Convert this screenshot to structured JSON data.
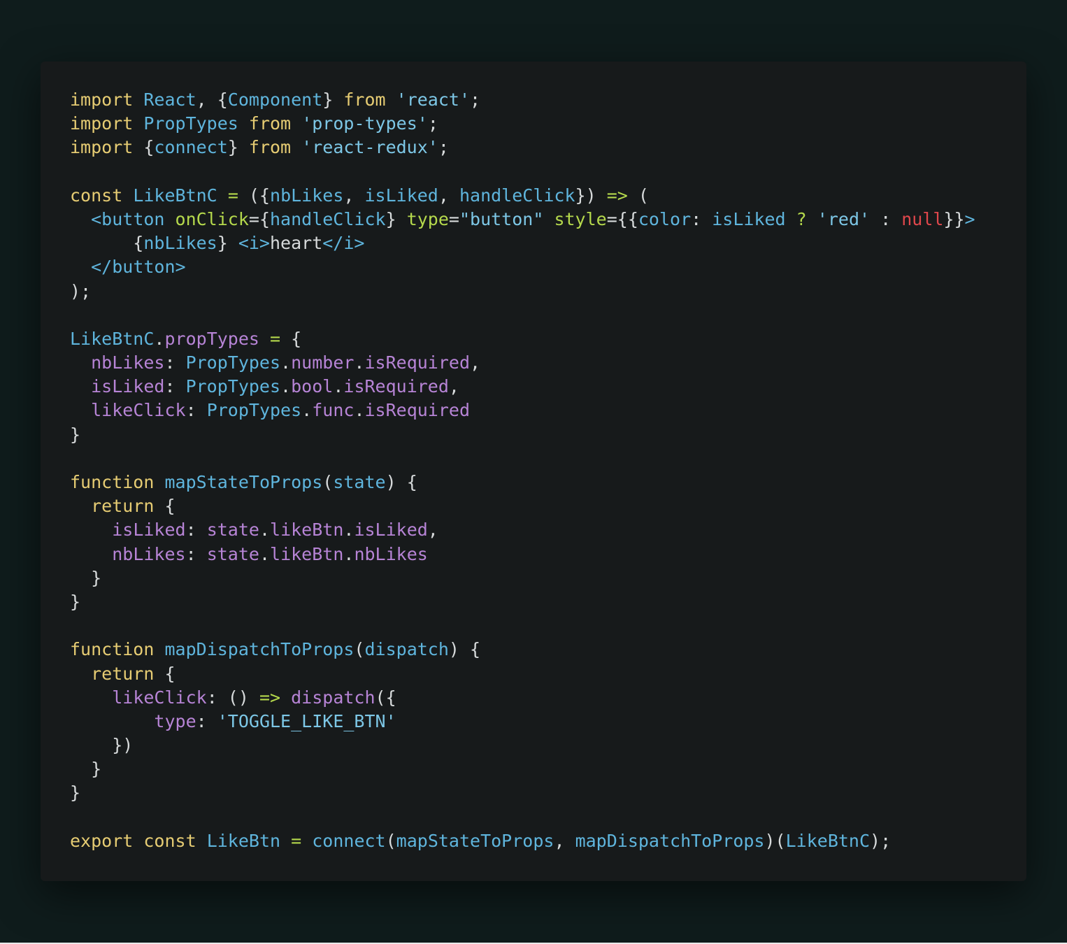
{
  "colors": {
    "page_background": "#0f1c1c",
    "card_background": "#171a1b",
    "plain": "#d7dadb",
    "keyword": "#e6cc73",
    "identifier": "#5fb5dd",
    "string": "#7dc7e6",
    "property": "#b784d6",
    "operator": "#b5d94c",
    "null": "#e0474c"
  },
  "code": {
    "lines": [
      [
        [
          "keyword",
          "import"
        ],
        [
          "plain",
          " "
        ],
        [
          "ident",
          "React"
        ],
        [
          "plain",
          ", {"
        ],
        [
          "ident",
          "Component"
        ],
        [
          "plain",
          "} "
        ],
        [
          "keyword",
          "from"
        ],
        [
          "plain",
          " "
        ],
        [
          "string",
          "'react'"
        ],
        [
          "plain",
          ";"
        ]
      ],
      [
        [
          "keyword",
          "import"
        ],
        [
          "plain",
          " "
        ],
        [
          "ident",
          "PropTypes"
        ],
        [
          "plain",
          " "
        ],
        [
          "keyword",
          "from"
        ],
        [
          "plain",
          " "
        ],
        [
          "string",
          "'prop-types'"
        ],
        [
          "plain",
          ";"
        ]
      ],
      [
        [
          "keyword",
          "import"
        ],
        [
          "plain",
          " {"
        ],
        [
          "ident",
          "connect"
        ],
        [
          "plain",
          "} "
        ],
        [
          "keyword",
          "from"
        ],
        [
          "plain",
          " "
        ],
        [
          "string",
          "'react-redux'"
        ],
        [
          "plain",
          ";"
        ]
      ],
      [],
      [
        [
          "keyword",
          "const"
        ],
        [
          "plain",
          " "
        ],
        [
          "ident",
          "LikeBtnC"
        ],
        [
          "plain",
          " "
        ],
        [
          "op",
          "="
        ],
        [
          "plain",
          " ({"
        ],
        [
          "ident",
          "nbLikes"
        ],
        [
          "plain",
          ", "
        ],
        [
          "ident",
          "isLiked"
        ],
        [
          "plain",
          ", "
        ],
        [
          "ident",
          "handleClick"
        ],
        [
          "plain",
          "}) "
        ],
        [
          "op",
          "=>"
        ],
        [
          "plain",
          " ("
        ]
      ],
      [
        [
          "plain",
          "  "
        ],
        [
          "tag",
          "<button"
        ],
        [
          "plain",
          " "
        ],
        [
          "jsxattr",
          "onClick"
        ],
        [
          "plain",
          "={"
        ],
        [
          "ident",
          "handleClick"
        ],
        [
          "plain",
          "} "
        ],
        [
          "jsxattr",
          "type"
        ],
        [
          "plain",
          "="
        ],
        [
          "string",
          "\"button\""
        ],
        [
          "plain",
          " "
        ],
        [
          "jsxattr",
          "style"
        ],
        [
          "plain",
          "={{"
        ],
        [
          "ident",
          "color"
        ],
        [
          "plain",
          ": "
        ],
        [
          "ident",
          "isLiked"
        ],
        [
          "plain",
          " "
        ],
        [
          "op",
          "?"
        ],
        [
          "plain",
          " "
        ],
        [
          "string",
          "'red'"
        ],
        [
          "plain",
          " : "
        ],
        [
          "null",
          "null"
        ],
        [
          "plain",
          "}}"
        ],
        [
          "tag",
          ">"
        ]
      ],
      [
        [
          "plain",
          "      {"
        ],
        [
          "ident",
          "nbLikes"
        ],
        [
          "plain",
          "} "
        ],
        [
          "tag",
          "<i>"
        ],
        [
          "plain",
          "heart"
        ],
        [
          "tag",
          "</i>"
        ]
      ],
      [
        [
          "plain",
          "  "
        ],
        [
          "tag",
          "</button>"
        ]
      ],
      [
        [
          "plain",
          ");"
        ]
      ],
      [],
      [
        [
          "ident",
          "LikeBtnC"
        ],
        [
          "plain",
          "."
        ],
        [
          "prop",
          "propTypes"
        ],
        [
          "plain",
          " "
        ],
        [
          "op",
          "="
        ],
        [
          "plain",
          " {"
        ]
      ],
      [
        [
          "plain",
          "  "
        ],
        [
          "prop",
          "nbLikes"
        ],
        [
          "plain",
          ": "
        ],
        [
          "ident",
          "PropTypes"
        ],
        [
          "plain",
          "."
        ],
        [
          "prop",
          "number"
        ],
        [
          "plain",
          "."
        ],
        [
          "prop",
          "isRequired"
        ],
        [
          "plain",
          ","
        ]
      ],
      [
        [
          "plain",
          "  "
        ],
        [
          "prop",
          "isLiked"
        ],
        [
          "plain",
          ": "
        ],
        [
          "ident",
          "PropTypes"
        ],
        [
          "plain",
          "."
        ],
        [
          "prop",
          "bool"
        ],
        [
          "plain",
          "."
        ],
        [
          "prop",
          "isRequired"
        ],
        [
          "plain",
          ","
        ]
      ],
      [
        [
          "plain",
          "  "
        ],
        [
          "prop",
          "likeClick"
        ],
        [
          "plain",
          ": "
        ],
        [
          "ident",
          "PropTypes"
        ],
        [
          "plain",
          "."
        ],
        [
          "prop",
          "func"
        ],
        [
          "plain",
          "."
        ],
        [
          "prop",
          "isRequired"
        ]
      ],
      [
        [
          "plain",
          "}"
        ]
      ],
      [],
      [
        [
          "keyword",
          "function"
        ],
        [
          "plain",
          " "
        ],
        [
          "ident",
          "mapStateToProps"
        ],
        [
          "plain",
          "("
        ],
        [
          "ident",
          "state"
        ],
        [
          "plain",
          ") {"
        ]
      ],
      [
        [
          "plain",
          "  "
        ],
        [
          "keyword",
          "return"
        ],
        [
          "plain",
          " {"
        ]
      ],
      [
        [
          "plain",
          "    "
        ],
        [
          "prop",
          "isLiked"
        ],
        [
          "plain",
          ": "
        ],
        [
          "prop",
          "state"
        ],
        [
          "plain",
          "."
        ],
        [
          "prop",
          "likeBtn"
        ],
        [
          "plain",
          "."
        ],
        [
          "prop",
          "isLiked"
        ],
        [
          "plain",
          ","
        ]
      ],
      [
        [
          "plain",
          "    "
        ],
        [
          "prop",
          "nbLikes"
        ],
        [
          "plain",
          ": "
        ],
        [
          "prop",
          "state"
        ],
        [
          "plain",
          "."
        ],
        [
          "prop",
          "likeBtn"
        ],
        [
          "plain",
          "."
        ],
        [
          "prop",
          "nbLikes"
        ]
      ],
      [
        [
          "plain",
          "  }"
        ]
      ],
      [
        [
          "plain",
          "}"
        ]
      ],
      [],
      [
        [
          "keyword",
          "function"
        ],
        [
          "plain",
          " "
        ],
        [
          "ident",
          "mapDispatchToProps"
        ],
        [
          "plain",
          "("
        ],
        [
          "ident",
          "dispatch"
        ],
        [
          "plain",
          ") {"
        ]
      ],
      [
        [
          "plain",
          "  "
        ],
        [
          "keyword",
          "return"
        ],
        [
          "plain",
          " {"
        ]
      ],
      [
        [
          "plain",
          "    "
        ],
        [
          "prop",
          "likeClick"
        ],
        [
          "plain",
          ": () "
        ],
        [
          "op",
          "=>"
        ],
        [
          "plain",
          " "
        ],
        [
          "prop",
          "dispatch"
        ],
        [
          "plain",
          "({"
        ]
      ],
      [
        [
          "plain",
          "        "
        ],
        [
          "prop",
          "type"
        ],
        [
          "plain",
          ": "
        ],
        [
          "string",
          "'TOGGLE_LIKE_BTN'"
        ]
      ],
      [
        [
          "plain",
          "    })"
        ]
      ],
      [
        [
          "plain",
          "  }"
        ]
      ],
      [
        [
          "plain",
          "}"
        ]
      ],
      [],
      [
        [
          "keyword",
          "export"
        ],
        [
          "plain",
          " "
        ],
        [
          "keyword",
          "const"
        ],
        [
          "plain",
          " "
        ],
        [
          "ident",
          "LikeBtn"
        ],
        [
          "plain",
          " "
        ],
        [
          "op",
          "="
        ],
        [
          "plain",
          " "
        ],
        [
          "ident",
          "connect"
        ],
        [
          "plain",
          "("
        ],
        [
          "ident",
          "mapStateToProps"
        ],
        [
          "plain",
          ", "
        ],
        [
          "ident",
          "mapDispatchToProps"
        ],
        [
          "plain",
          ")("
        ],
        [
          "ident",
          "LikeBtnC"
        ],
        [
          "plain",
          ");"
        ]
      ]
    ]
  }
}
